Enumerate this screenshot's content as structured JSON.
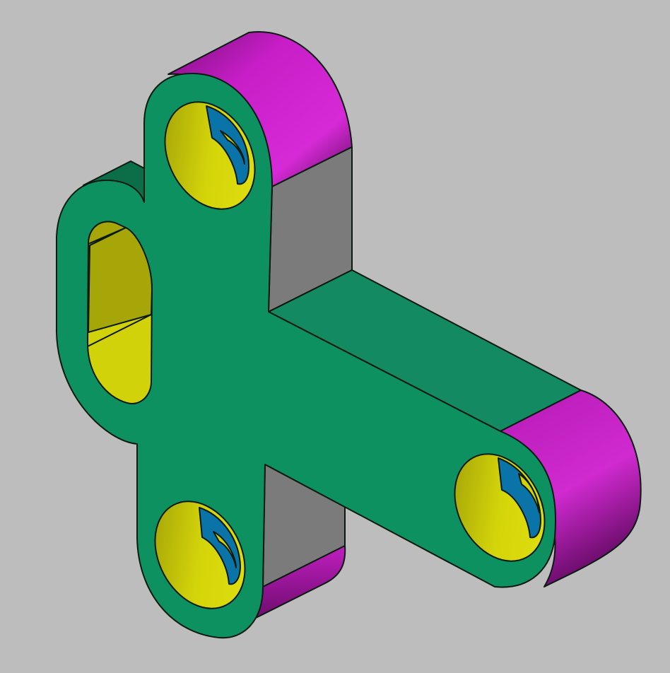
{
  "viewport": {
    "background": "#bdbdbd"
  },
  "model": {
    "colors": {
      "top_face": "#0e9161",
      "top_face_dark": "#0b7d52",
      "side_flat": "#7b7b7b",
      "cylinder_outer": "#c81ec8",
      "hole_wall": "#d2d20a",
      "hole_wall_shade": "#a8a80a",
      "counterbore_step": "#0a74a8",
      "edge": "#0a1a10"
    },
    "features": [
      "t-shaped-plate",
      "slotted-hole",
      "counterbored-hole-top",
      "counterbored-hole-bottom",
      "counterbored-hole-right"
    ]
  }
}
